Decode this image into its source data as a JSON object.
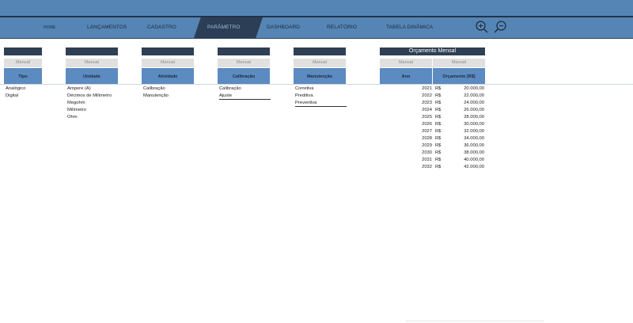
{
  "nav": {
    "items": [
      {
        "label": "HOME"
      },
      {
        "label": "LANÇAMENTOS"
      },
      {
        "label": "CADASTRO"
      },
      {
        "label": "PARÂMETRO"
      },
      {
        "label": "DASHBOARD"
      },
      {
        "label": "RELATÓRIO"
      },
      {
        "label": "TABELA DINÂMICA"
      }
    ],
    "active": "PARÂMETRO",
    "zoom_in_icon": "zoom-in-icon",
    "zoom_out_icon": "zoom-out-icon"
  },
  "params": {
    "manual_label": "Manual",
    "tipo": {
      "header": "Tipo",
      "items": [
        "Analógico",
        "Digital"
      ]
    },
    "unidade": {
      "header": "Unidade",
      "items": [
        "Ampere (A)",
        "Décimos de Milímetro",
        "Megohm",
        "Milímetro",
        "Ohm"
      ]
    },
    "atividade": {
      "header": "Atividade",
      "items": [
        "Calibração",
        "Manutenção"
      ]
    },
    "calibracao": {
      "header": "Calibração",
      "items": [
        "Calibração",
        "Ajuste"
      ]
    },
    "manutencao": {
      "header": "Manutenção",
      "items": [
        "Corretiva",
        "Preditiva",
        "Preventiva"
      ]
    }
  },
  "budget": {
    "title": "Orçamento Mensal",
    "manual_ano": "Manual",
    "manual_orc": "Manual",
    "col_ano": "Ano",
    "col_orcamento": "Orçamento [R$]",
    "currency": "R$",
    "rows": [
      {
        "ano": "2021",
        "valor": "20.000,00"
      },
      {
        "ano": "2022",
        "valor": "22.000,00"
      },
      {
        "ano": "2023",
        "valor": "24.000,00"
      },
      {
        "ano": "2024",
        "valor": "26.000,00"
      },
      {
        "ano": "2025",
        "valor": "28.000,00"
      },
      {
        "ano": "2026",
        "valor": "30.000,00"
      },
      {
        "ano": "2027",
        "valor": "32.000,00"
      },
      {
        "ano": "2028",
        "valor": "34.000,00"
      },
      {
        "ano": "2029",
        "valor": "36.000,00"
      },
      {
        "ano": "2030",
        "valor": "38.000,00"
      },
      {
        "ano": "2031",
        "valor": "40.000,00"
      },
      {
        "ano": "2032",
        "valor": "42.000,00"
      }
    ]
  },
  "colors": {
    "nav_bg": "#5585b5",
    "nav_active": "#2c3e55",
    "header_dark": "#2f3f54",
    "header_blue": "#5b8bc0",
    "manual_bg": "#e0e0e0"
  }
}
